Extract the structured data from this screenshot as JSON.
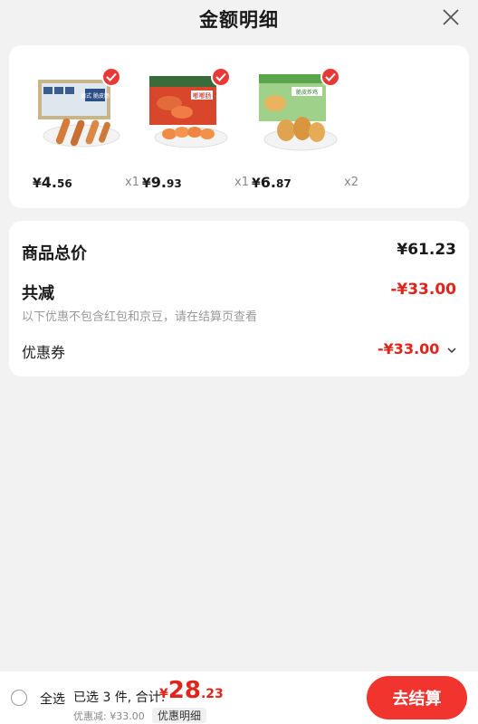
{
  "header": {
    "title": "金额明细"
  },
  "products": [
    {
      "price_int": "4.",
      "price_dec": "56",
      "qty": "x1",
      "pack_text": "德式 脆皮肠"
    },
    {
      "price_int": "9.",
      "price_dec": "93",
      "qty": "x1",
      "pack_text": "嘟嘟肠"
    },
    {
      "price_int": "6.",
      "price_dec": "87",
      "qty": "x2",
      "pack_text": "脆皮炸鸡"
    }
  ],
  "currency": "¥",
  "summary": {
    "total_label": "商品总价",
    "total_value": "¥61.23",
    "reduce_label": "共减",
    "reduce_value": "-¥33.00",
    "note": "以下优惠不包含红包和京豆，请在结算页查看",
    "coupon_label": "优惠券",
    "coupon_value": "-¥33.00"
  },
  "bottom": {
    "select_all": "全选",
    "selected_text": "已选 3 件, 合计:",
    "total_int": "28",
    "total_dec": ".23",
    "discount_text": "优惠减: ¥33.00",
    "detail_label": "优惠明细",
    "checkout_label": "去结算"
  },
  "colors": {
    "accent": "#e2231a",
    "button": "#f2342f"
  }
}
